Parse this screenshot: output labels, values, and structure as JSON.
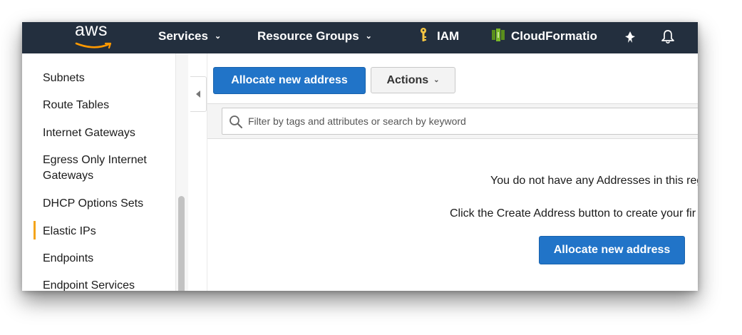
{
  "nav": {
    "logo": "aws",
    "services": "Services",
    "resource_groups": "Resource Groups",
    "iam": "IAM",
    "cloudformation": "CloudFormatio",
    "icons": [
      "key-icon",
      "cloudformation-icon",
      "pin-icon",
      "bell-icon",
      "caret-down-icon"
    ]
  },
  "sidebar": {
    "items": [
      {
        "label": "Subnets"
      },
      {
        "label": "Route Tables"
      },
      {
        "label": "Internet Gateways"
      },
      {
        "label": "Egress Only Internet Gateways"
      },
      {
        "label": "DHCP Options Sets"
      },
      {
        "label": "Elastic IPs",
        "active": true
      },
      {
        "label": "Endpoints"
      },
      {
        "label": "Endpoint Services"
      }
    ]
  },
  "toolbar": {
    "allocate_label": "Allocate new address",
    "actions_label": "Actions"
  },
  "filter": {
    "placeholder": "Filter by tags and attributes or search by keyword"
  },
  "empty_state": {
    "line1": "You do not have any Addresses in this reg",
    "line2": "Click the Create Address button to create your fir",
    "button_label": "Allocate new address"
  },
  "colors": {
    "nav_bg": "#232f3e",
    "primary": "#2174c8",
    "active_marker": "#f4a41a",
    "key_icon": "#f4c542",
    "cloudformation_icon": "#7ab829",
    "logo_smile": "#ff9900"
  }
}
